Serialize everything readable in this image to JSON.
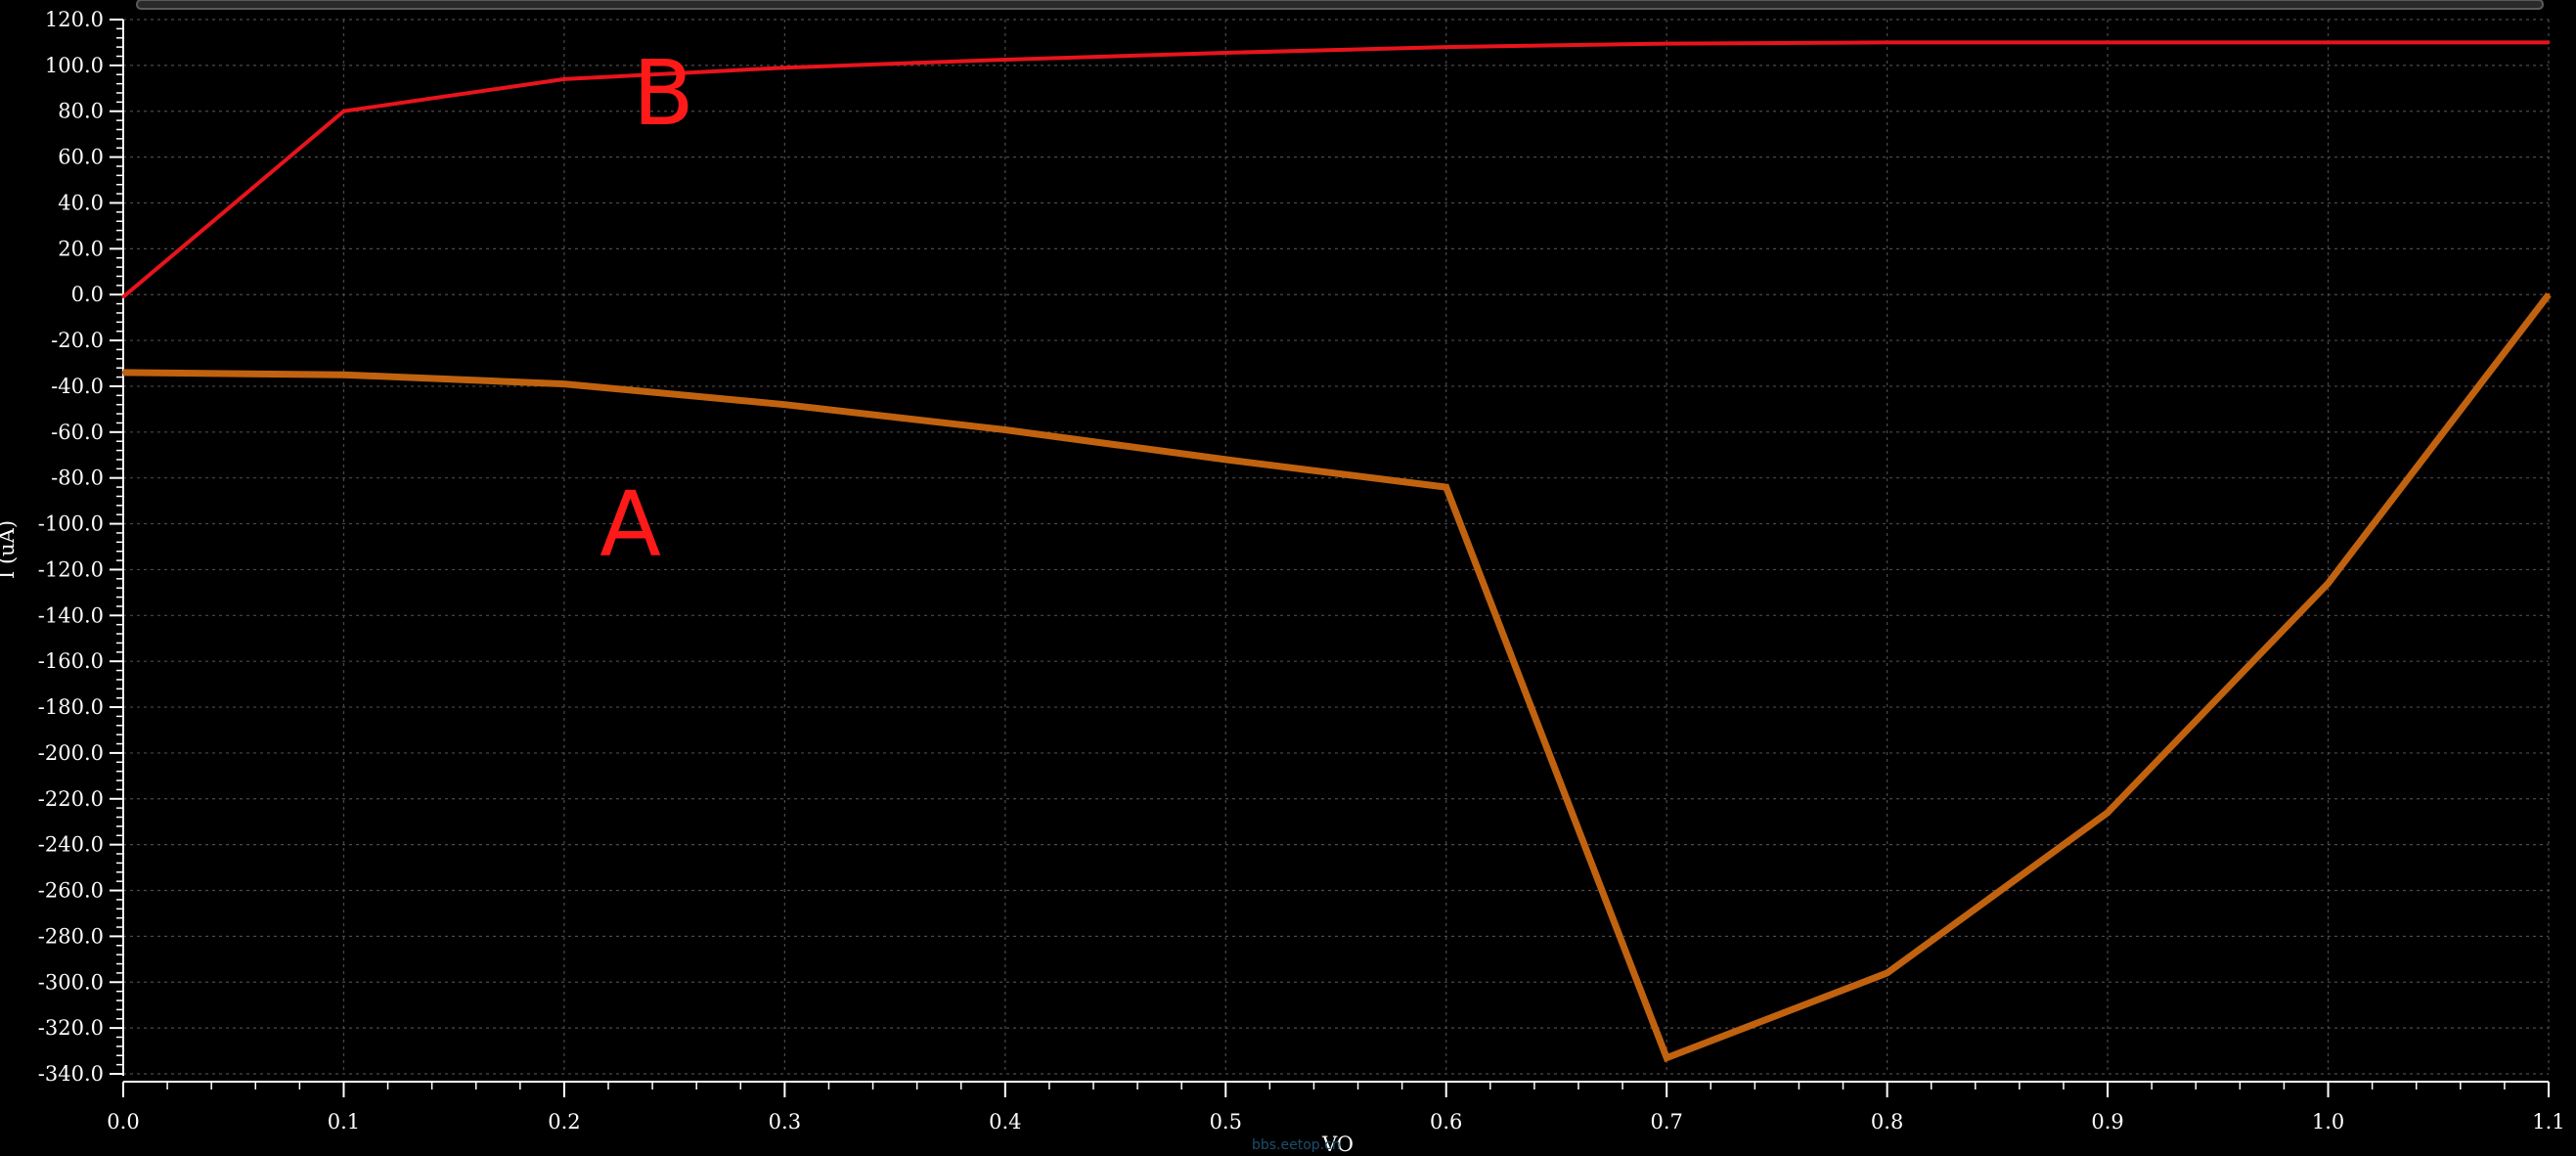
{
  "chart_data": {
    "type": "line",
    "xlabel": "VO",
    "ylabel": "I (uA)",
    "xlim": [
      0.0,
      1.1
    ],
    "ylim": [
      -340.0,
      120.0
    ],
    "grid": true,
    "x_ticks": [
      "0.0",
      "0.1",
      "0.2",
      "0.3",
      "0.4",
      "0.5",
      "0.6",
      "0.7",
      "0.8",
      "0.9",
      "1.0",
      "1.1"
    ],
    "y_ticks": [
      "120.0",
      "100.0",
      "80.0",
      "60.0",
      "40.0",
      "20.0",
      "0.0",
      "-20.0",
      "-40.0",
      "-60.0",
      "-80.0",
      "-100.0",
      "-120.0",
      "-140.0",
      "-160.0",
      "-180.0",
      "-200.0",
      "-220.0",
      "-240.0",
      "-260.0",
      "-280.0",
      "-300.0",
      "-320.0",
      "-340.0"
    ],
    "series": [
      {
        "label": "B",
        "color": "#e8141c",
        "x": [
          0.0,
          0.1,
          0.2,
          0.3,
          0.4,
          0.5,
          0.6,
          0.7,
          0.8,
          0.9,
          1.0,
          1.1
        ],
        "y": [
          -1.0,
          80.0,
          94.0,
          99.0,
          102.5,
          105.5,
          108.0,
          109.5,
          110.0,
          110.0,
          110.0,
          110.0
        ]
      },
      {
        "label": "A",
        "color": "#c0620f",
        "x": [
          0.0,
          0.1,
          0.2,
          0.3,
          0.4,
          0.5,
          0.6,
          0.7,
          0.8,
          0.9,
          1.0,
          1.1
        ],
        "y": [
          -34.0,
          -35.0,
          -39.0,
          -48.0,
          -59.0,
          -72.0,
          -84.0,
          -333.0,
          -296.0,
          -226.0,
          -126.0,
          0.0
        ]
      }
    ],
    "annotations": [
      {
        "text": "B",
        "color": "#ff1a1a",
        "x": 0.245,
        "y": 88
      },
      {
        "text": "A",
        "color": "#ff1a1a",
        "x": 0.23,
        "y": -100
      }
    ]
  },
  "watermark": "bbs.eetop.cn"
}
